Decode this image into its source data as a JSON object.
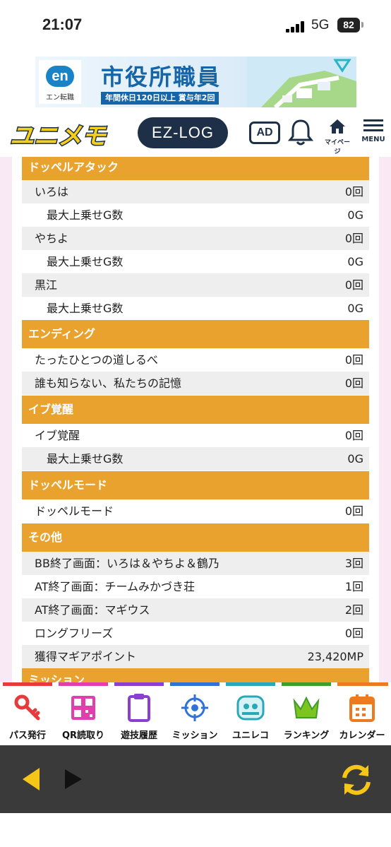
{
  "status": {
    "time": "21:07",
    "network": "5G",
    "battery": "82"
  },
  "banner": {
    "logo_text": "en",
    "logo_sub": "エン転職",
    "headline": "市役所職員",
    "tagline": "年間休日120日以上 賞与年2回"
  },
  "header": {
    "brand": "ユニメモ",
    "ezlog": "EZ-LOG",
    "ad": "AD",
    "mypage": "マイページ",
    "menu": "MENU"
  },
  "sections": [
    {
      "title": "ドッペルアタック",
      "rows": [
        {
          "label": "いろは",
          "value": "0回"
        },
        {
          "label": "最大上乗せG数",
          "value": "0G"
        },
        {
          "label": "やちよ",
          "value": "0回"
        },
        {
          "label": "最大上乗せG数",
          "value": "0G"
        },
        {
          "label": "黒江",
          "value": "0回"
        },
        {
          "label": "最大上乗せG数",
          "value": "0G"
        }
      ]
    },
    {
      "title": "エンディング",
      "rows": [
        {
          "label": "たったひとつの道しるべ",
          "value": "0回"
        },
        {
          "label": "誰も知らない、私たちの記憶",
          "value": "0回"
        }
      ]
    },
    {
      "title": "イブ覚醒",
      "rows": [
        {
          "label": "イブ覚醒",
          "value": "0回"
        },
        {
          "label": "最大上乗せG数",
          "value": "0G"
        }
      ]
    },
    {
      "title": "ドッペルモード",
      "rows": [
        {
          "label": "ドッペルモード",
          "value": "0回"
        }
      ]
    },
    {
      "title": "その他",
      "rows": [
        {
          "label": "BB終了画面：いろは＆やちよ＆鶴乃",
          "value": "3回"
        },
        {
          "label": "AT終了画面：チームみかづき荘",
          "value": "1回"
        },
        {
          "label": "AT終了画面：マギウス",
          "value": "2回"
        },
        {
          "label": "ロングフリーズ",
          "value": "0回"
        },
        {
          "label": "獲得マギアポイント",
          "value": "23,420MP"
        }
      ]
    },
    {
      "title": "ミッション",
      "rows": []
    }
  ],
  "bottom_nav": [
    {
      "label": "パス発行",
      "icon": "key-icon",
      "color": "#e8393b"
    },
    {
      "label": "QR読取り",
      "icon": "qr-code-icon",
      "color": "#e23fae"
    },
    {
      "label": "遊技履歴",
      "icon": "clipboard-icon",
      "color": "#8a3fd0"
    },
    {
      "label": "ミッション",
      "icon": "crosshair-icon",
      "color": "#2f73d8"
    },
    {
      "label": "ユニレコ",
      "icon": "unireco-logo-icon",
      "color": "#27a9b8"
    },
    {
      "label": "ランキング",
      "icon": "crown-icon",
      "color": "#3f9d2a"
    },
    {
      "label": "カレンダー",
      "icon": "calendar-icon",
      "color": "#ee7a1f"
    }
  ],
  "colors": {
    "section_bg": "#e8a22d",
    "page_bg": "#f9e9f4",
    "header_navy": "#1e2f48",
    "brand_yellow": "#f5cf1a"
  }
}
